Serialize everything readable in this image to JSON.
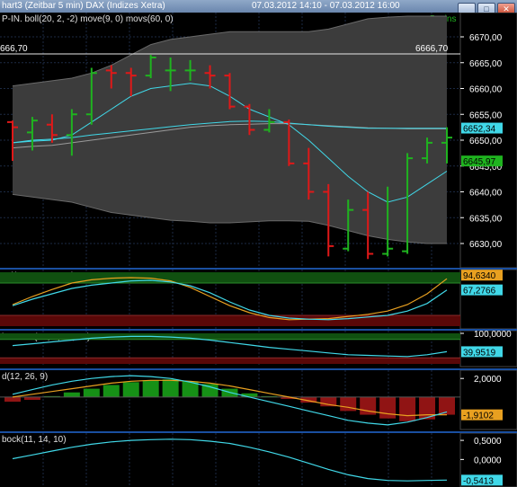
{
  "window": {
    "title": "hart3 (Zeitbar 5 min)  DAX (Indizes Xetra)",
    "range": "07.03.2012 14:10 - 07.03.2012 16:00",
    "buttons": [
      "_",
      "□",
      "✕"
    ]
  },
  "colors": {
    "up": "#1fb31f",
    "down": "#e01818",
    "band_fill": "#3c3c3c",
    "mid_line": "#40d8e8",
    "avg_line": "#9a9a9a",
    "axis_text": "#ffffff",
    "grid": "#1c2a44",
    "indicator_line": "#40d8e8",
    "signal_line": "#e8a020",
    "zone_green": "#105010",
    "zone_red": "#5a0808",
    "macd_pos": "#169016",
    "macd_neg": "#901414"
  },
  "chart_data": [
    {
      "type": "candlestick",
      "header": "P-IN. boll(20, 2, -2) move(9, 0) movs(60, 0)",
      "interval_label": "5 mins",
      "ylim": [
        6626,
        6674
      ],
      "y_ticks": [
        "6670,00",
        "6665,00",
        "6660,00",
        "6655,00",
        "6650,00",
        "6645,00",
        "6640,00",
        "6635,00",
        "6630,00"
      ],
      "y_tick_values": [
        6670,
        6665,
        6660,
        6655,
        6650,
        6645,
        6640,
        6635,
        6630
      ],
      "hline": {
        "value": 6666.7,
        "label_left": "666,70",
        "label_right": "6666,70"
      },
      "last_price_tags": [
        {
          "value": 6652.34,
          "label": "6652,34",
          "color": "#40d8e8"
        },
        {
          "value": 6645.97,
          "label": "6645,97",
          "color": "#1fb31f"
        }
      ],
      "bars": [
        {
          "o": 6653.5,
          "h": 6653.8,
          "l": 6646,
          "c": 6652.5
        },
        {
          "o": 6651.5,
          "h": 6654.5,
          "l": 6648,
          "c": 6653.8
        },
        {
          "o": 6653,
          "h": 6655,
          "l": 6649.5,
          "c": 6651
        },
        {
          "o": 6651,
          "h": 6656,
          "l": 6647,
          "c": 6655
        },
        {
          "o": 6655,
          "h": 6664,
          "l": 6653,
          "c": 6663
        },
        {
          "o": 6663.5,
          "h": 6664.5,
          "l": 6660,
          "c": 6663
        },
        {
          "o": 6663,
          "h": 6664,
          "l": 6658.5,
          "c": 6662.5
        },
        {
          "o": 6662.5,
          "h": 6666.5,
          "l": 6662,
          "c": 6666
        },
        {
          "o": 6663.5,
          "h": 6666,
          "l": 6659.5,
          "c": 6663.5
        },
        {
          "o": 6663.5,
          "h": 6665.5,
          "l": 6661.5,
          "c": 6663.5
        },
        {
          "o": 6663,
          "h": 6664.5,
          "l": 6660,
          "c": 6662.5
        },
        {
          "o": 6662.5,
          "h": 6663,
          "l": 6656,
          "c": 6656.5
        },
        {
          "o": 6656.5,
          "h": 6657,
          "l": 6651,
          "c": 6652
        },
        {
          "o": 6652,
          "h": 6656,
          "l": 6651.5,
          "c": 6653.5
        },
        {
          "o": 6653.5,
          "h": 6654,
          "l": 6645,
          "c": 6645.5
        },
        {
          "o": 6645.5,
          "h": 6648.5,
          "l": 6638.5,
          "c": 6640
        },
        {
          "o": 6640,
          "h": 6641.5,
          "l": 6627.5,
          "c": 6629.5
        },
        {
          "o": 6629,
          "h": 6638.5,
          "l": 6628.5,
          "c": 6636.5
        },
        {
          "o": 6636.5,
          "h": 6640,
          "l": 6627,
          "c": 6628
        },
        {
          "o": 6628,
          "h": 6641,
          "l": 6627.5,
          "c": 6629
        },
        {
          "o": 6628.5,
          "h": 6647.5,
          "l": 6628,
          "c": 6646.5
        },
        {
          "o": 6646.5,
          "h": 6650.5,
          "l": 6645.5,
          "c": 6649.5
        },
        {
          "o": 6649.5,
          "h": 6652.5,
          "l": 6645.5,
          "c": 6650.5
        }
      ],
      "band_upper": [
        6660.5,
        6661,
        6661.5,
        6662,
        6663,
        6664.5,
        6666.5,
        6668.5,
        6669.5,
        6670,
        6670.5,
        6671,
        6671,
        6671,
        6671,
        6671,
        6671.5,
        6672.5,
        6673.5,
        6673.8,
        6674,
        6674,
        6674
      ],
      "band_lower": [
        6639.5,
        6639,
        6638.5,
        6638,
        6637,
        6636,
        6635.5,
        6635,
        6634.5,
        6634.3,
        6634,
        6634,
        6634.2,
        6634.4,
        6634.4,
        6634.3,
        6633.5,
        6632.5,
        6631.5,
        6630.8,
        6630.3,
        6630,
        6630
      ],
      "ma_fast": [
        6649.5,
        6649.8,
        6650,
        6651,
        6653.5,
        6656,
        6658.5,
        6660,
        6660.5,
        6661,
        6660.5,
        6658.5,
        6656,
        6654.5,
        6653,
        6650,
        6646.5,
        6643,
        6640,
        6638,
        6639,
        6641.5,
        6644
      ],
      "ma_slow": [
        6649.5,
        6650,
        6650.2,
        6650.5,
        6651,
        6651.4,
        6651.8,
        6652.2,
        6652.6,
        6653,
        6653.3,
        6653.6,
        6653.7,
        6653.6,
        6653.3,
        6653,
        6652.7,
        6652.5,
        6652.3,
        6652.3,
        6652.3,
        6652.3,
        6652.3
      ],
      "ma_avg": [
        6648.5,
        6648.8,
        6649,
        6649.5,
        6650,
        6650.5,
        6651,
        6651.5,
        6652,
        6652.5,
        6652.8,
        6653,
        6653.1,
        6653.2,
        6653.2,
        6653,
        6652.8,
        6652.6,
        6652.4,
        6652.3,
        6652.2,
        6652.2,
        6652.2
      ]
    },
    {
      "type": "line",
      "header": "_sl(5, 3, 3, 80, 20)",
      "ylim": [
        0,
        100
      ],
      "zones": {
        "upper": 80,
        "lower": 20
      },
      "tags": [
        {
          "value": 94.634,
          "label": "94,6340",
          "color": "#e8a020"
        },
        {
          "value": 67.2766,
          "label": "67,2766",
          "color": "#40d8e8"
        }
      ],
      "series": [
        {
          "color": "#e8a020",
          "values": [
            40,
            55,
            68,
            80,
            86,
            89,
            90,
            89,
            84,
            72,
            55,
            38,
            25,
            16,
            12,
            13,
            14,
            18,
            22,
            28,
            40,
            60,
            88
          ]
        },
        {
          "color": "#40d8e8",
          "values": [
            38,
            50,
            60,
            70,
            76,
            80,
            84,
            85,
            82,
            75,
            62,
            45,
            30,
            20,
            15,
            13,
            12,
            14,
            17,
            20,
            28,
            42,
            67
          ]
        }
      ]
    },
    {
      "type": "line",
      "header": "bressert(21, 3, 80, 20)",
      "ylim": [
        0,
        100
      ],
      "zones": {
        "upper": 80,
        "lower": 20
      },
      "tags": [
        {
          "value": 100,
          "label": "100,0000",
          "color": "#ffffff"
        },
        {
          "value": 39.9519,
          "label": "39,9519",
          "color": "#40d8e8"
        }
      ],
      "series": [
        {
          "color": "#40d8e8",
          "values": [
            60,
            66,
            72,
            78,
            84,
            88,
            90,
            90,
            88,
            84,
            78,
            70,
            62,
            54,
            48,
            42,
            36,
            30,
            28,
            26,
            24,
            30,
            40
          ]
        }
      ]
    },
    {
      "type": "bar",
      "header": "d(12, 26, 9)",
      "ylim": [
        -3.2,
        2.6
      ],
      "tags": [
        {
          "value": 2.0,
          "label": "2,0000",
          "color": "#ffffff"
        },
        {
          "value": -1.9102,
          "label": "-1,9102",
          "color": "#e8a020"
        }
      ],
      "zero_label": "",
      "histogram": [
        -0.5,
        -0.3,
        0.1,
        0.5,
        0.9,
        1.3,
        1.6,
        1.8,
        1.9,
        1.7,
        1.4,
        0.9,
        0.4,
        0.1,
        -0.2,
        -0.6,
        -1.0,
        -1.5,
        -1.9,
        -2.3,
        -2.6,
        -2.4,
        -1.9
      ],
      "series": [
        {
          "color": "#e8a020",
          "values": [
            0.0,
            0.3,
            0.6,
            0.9,
            1.2,
            1.5,
            1.7,
            1.8,
            1.8,
            1.7,
            1.5,
            1.2,
            0.8,
            0.4,
            0.0,
            -0.4,
            -0.8,
            -1.1,
            -1.5,
            -1.8,
            -2.0,
            -1.9,
            -1.9
          ]
        },
        {
          "color": "#40d8e8",
          "values": [
            0.3,
            0.8,
            1.3,
            1.7,
            2.0,
            2.2,
            2.3,
            2.2,
            2.0,
            1.6,
            1.1,
            0.5,
            0.0,
            -0.5,
            -1.0,
            -1.5,
            -2.0,
            -2.5,
            -2.8,
            -3.0,
            -2.7,
            -2.2,
            -1.6
          ]
        }
      ]
    },
    {
      "type": "line",
      "header": "bock(11, 14, 10)",
      "ylim": [
        -0.65,
        0.62
      ],
      "tags": [
        {
          "value": 0.5,
          "label": "0,5000",
          "color": "#ffffff"
        },
        {
          "value": 0.0,
          "label": "0,0000",
          "color": "#ffffff"
        },
        {
          "value": -0.5413,
          "label": "-0,5413",
          "color": "#40d8e8"
        }
      ],
      "series": [
        {
          "color": "#40d8e8",
          "values": [
            0.02,
            0.12,
            0.22,
            0.32,
            0.4,
            0.46,
            0.5,
            0.52,
            0.53,
            0.52,
            0.48,
            0.42,
            0.32,
            0.2,
            0.06,
            -0.1,
            -0.26,
            -0.4,
            -0.5,
            -0.55,
            -0.56,
            -0.55,
            -0.54
          ]
        }
      ]
    }
  ]
}
